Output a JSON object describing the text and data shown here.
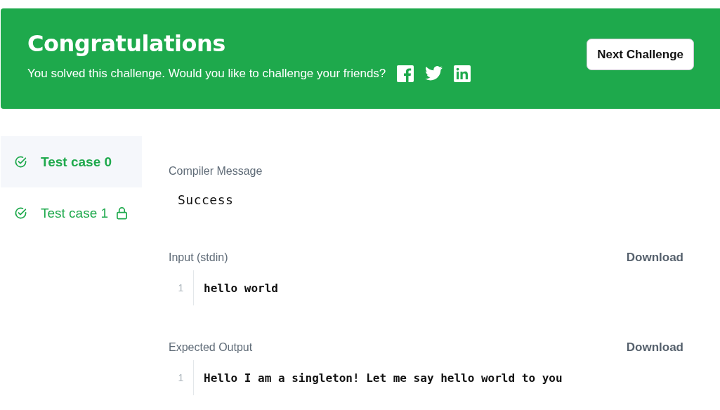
{
  "banner": {
    "title": "Congratulations",
    "message": "You solved this challenge. Would you like to challenge your friends?",
    "share": [
      {
        "kind": "facebook"
      },
      {
        "kind": "twitter"
      },
      {
        "kind": "linkedin"
      }
    ],
    "button": "Next Challenge"
  },
  "test_cases": [
    {
      "label": "Test case 0",
      "selected": true,
      "passed": true,
      "locked": false
    },
    {
      "label": "Test case 1",
      "selected": false,
      "passed": true,
      "locked": true
    }
  ],
  "compiler_message": {
    "label": "Compiler Message",
    "value": "Success"
  },
  "sections": [
    {
      "label": "Input (stdin)",
      "download": "Download",
      "lines": [
        {
          "number": "1",
          "text": "hello world"
        }
      ]
    },
    {
      "label": "Expected Output",
      "download": "Download",
      "lines": [
        {
          "number": "1",
          "text": "Hello I am a singleton! Let me say hello world to you"
        }
      ]
    }
  ]
}
